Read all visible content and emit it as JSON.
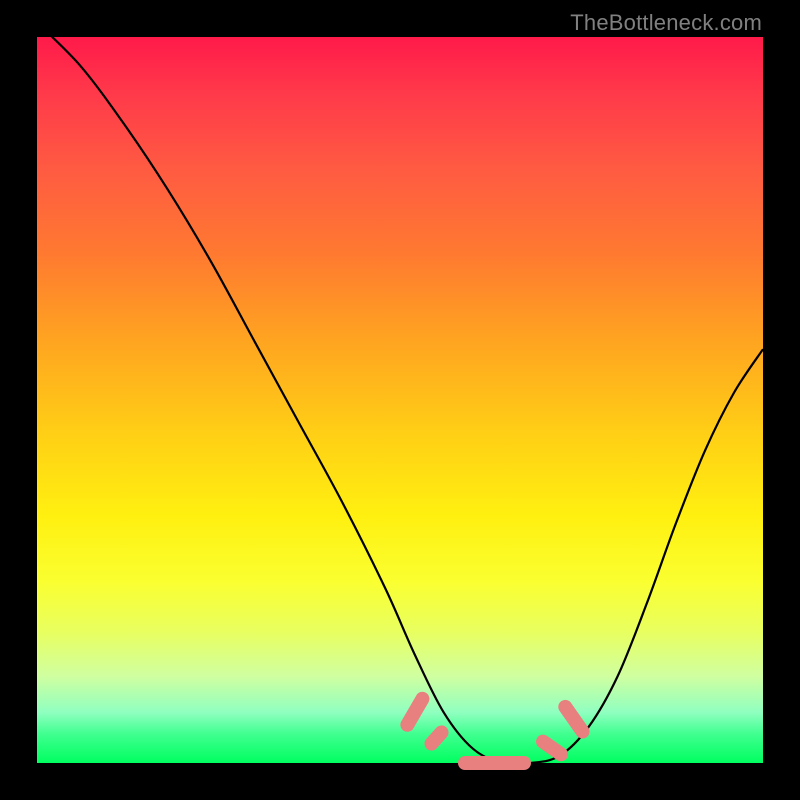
{
  "watermark": "TheBottleneck.com",
  "chart_data": {
    "type": "line",
    "title": "",
    "xlabel": "",
    "ylabel": "",
    "xlim": [
      0,
      100
    ],
    "ylim": [
      0,
      100
    ],
    "series": [
      {
        "name": "bottleneck-curve",
        "x": [
          0,
          6,
          12,
          18,
          24,
          30,
          36,
          42,
          48,
          52,
          56,
          60,
          64,
          68,
          72,
          76,
          80,
          84,
          88,
          92,
          96,
          100
        ],
        "values": [
          102,
          96,
          88,
          79,
          69,
          58,
          47,
          36,
          24,
          15,
          7,
          2,
          0,
          0,
          1,
          5,
          12,
          22,
          33,
          43,
          51,
          57
        ]
      }
    ],
    "markers": [
      {
        "name": "segment-left-edge",
        "x": 52,
        "y": 7,
        "angle_deg": -60,
        "length": 6
      },
      {
        "name": "segment-left-mid",
        "x": 55,
        "y": 3.5,
        "angle_deg": -48,
        "length": 4
      },
      {
        "name": "segment-bottom",
        "x": 63,
        "y": 0,
        "angle_deg": 0,
        "length": 10
      },
      {
        "name": "segment-right-mid",
        "x": 71,
        "y": 2,
        "angle_deg": 35,
        "length": 5
      },
      {
        "name": "segment-right-edge",
        "x": 74,
        "y": 6,
        "angle_deg": 55,
        "length": 6
      }
    ],
    "gradient_stops": [
      {
        "pct": 0,
        "color": "#ff1a4a"
      },
      {
        "pct": 50,
        "color": "#ffd015"
      },
      {
        "pct": 100,
        "color": "#00ff60"
      }
    ]
  }
}
